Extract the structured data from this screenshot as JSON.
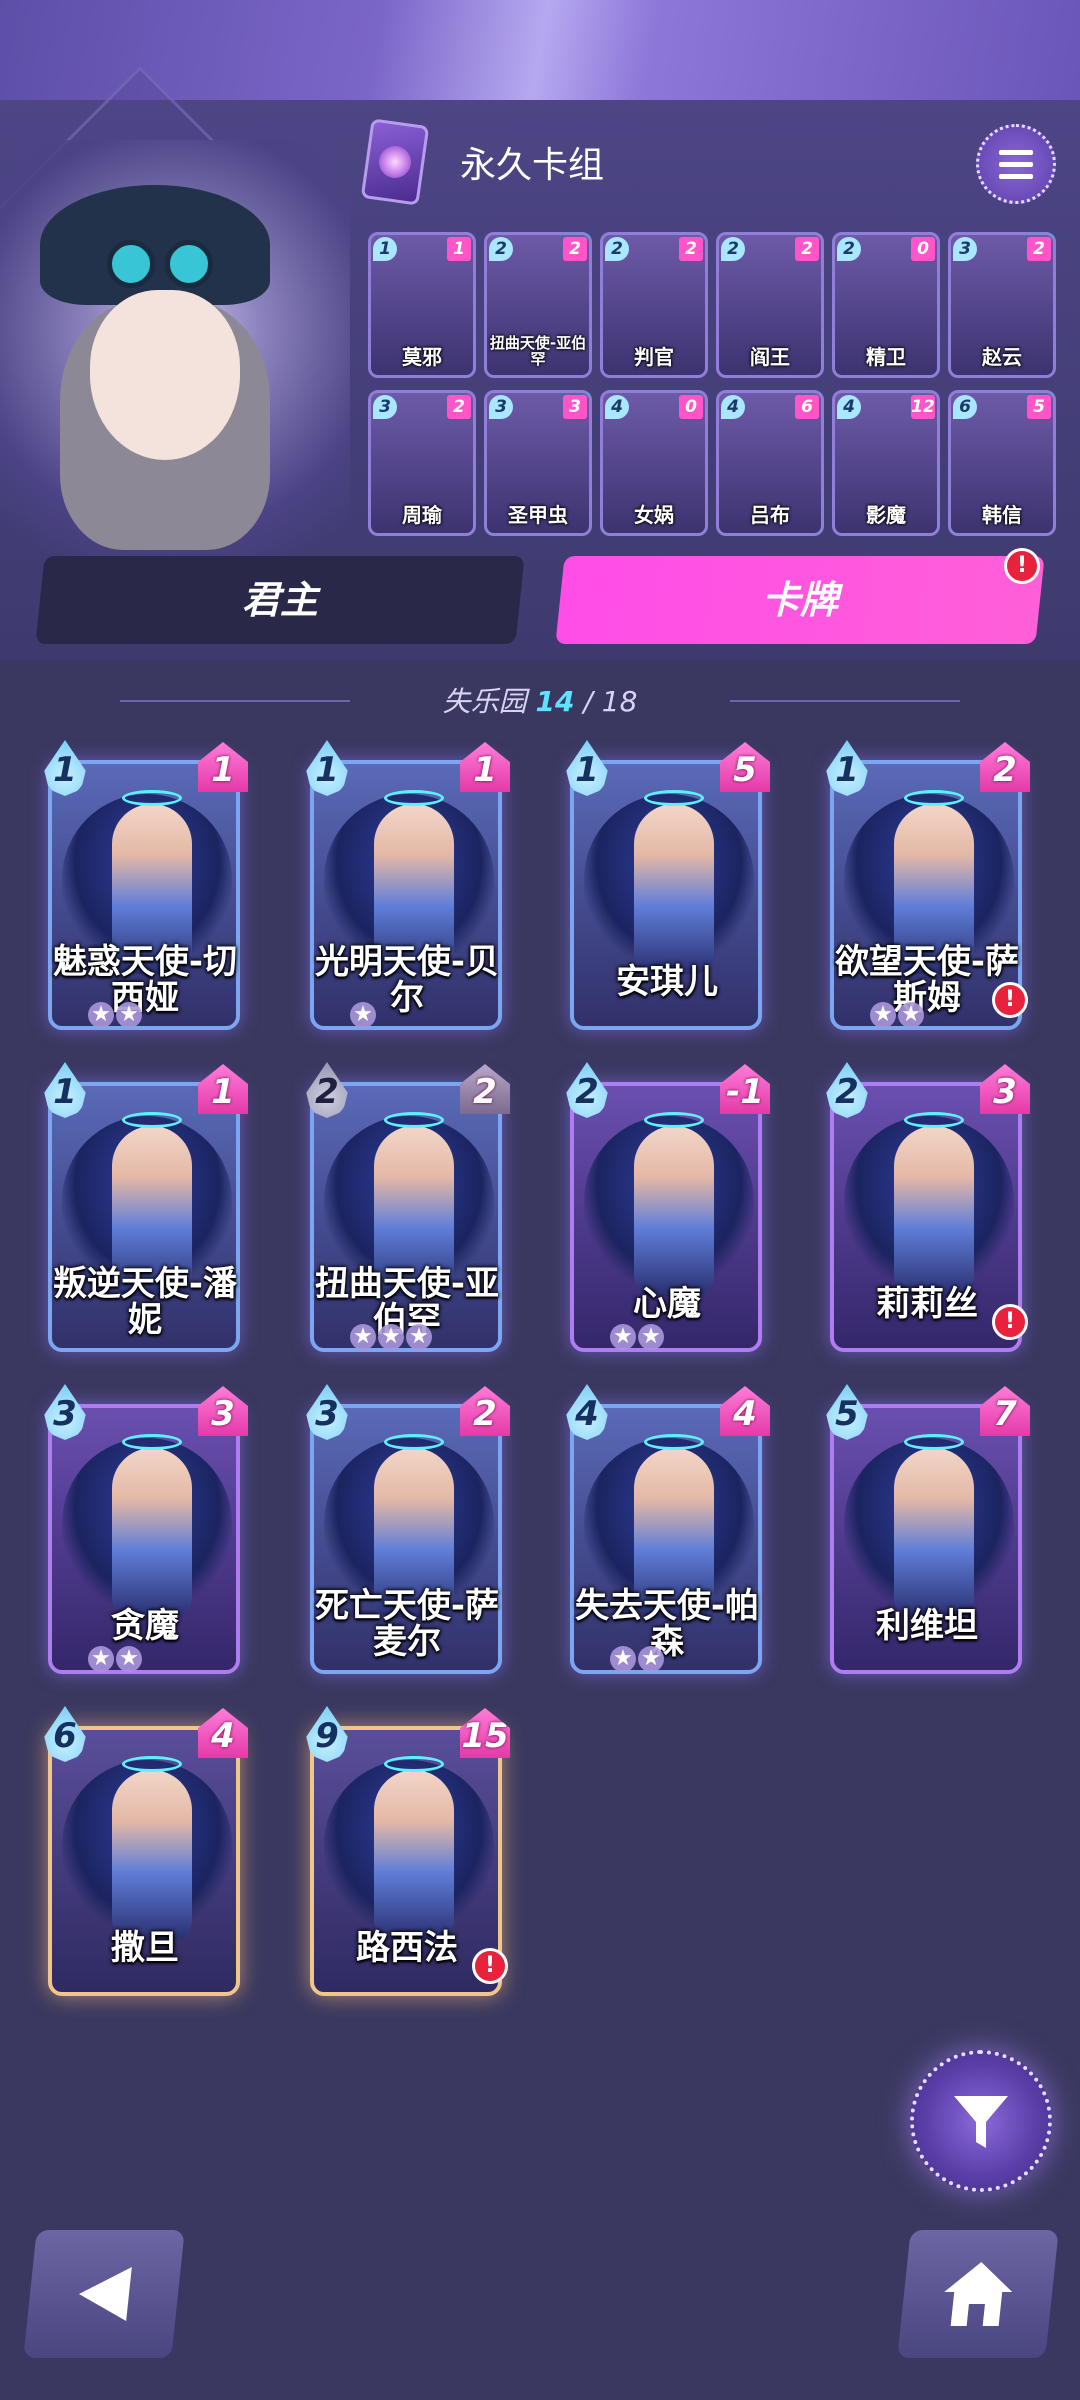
{
  "header": {
    "deck_title": "永久卡组"
  },
  "tabs": [
    {
      "label": "君主"
    },
    {
      "label": "卡牌"
    }
  ],
  "alert_mark": "!",
  "deck_cards": [
    {
      "cost": "1",
      "power": "1",
      "name": "莫邪"
    },
    {
      "cost": "2",
      "power": "2",
      "name": "扭曲天使-亚伯罕"
    },
    {
      "cost": "2",
      "power": "2",
      "name": "判官"
    },
    {
      "cost": "2",
      "power": "2",
      "name": "阎王"
    },
    {
      "cost": "2",
      "power": "0",
      "name": "精卫"
    },
    {
      "cost": "3",
      "power": "2",
      "name": "赵云"
    },
    {
      "cost": "3",
      "power": "2",
      "name": "周瑜"
    },
    {
      "cost": "3",
      "power": "3",
      "name": "圣甲虫"
    },
    {
      "cost": "4",
      "power": "0",
      "name": "女娲"
    },
    {
      "cost": "4",
      "power": "6",
      "name": "吕布"
    },
    {
      "cost": "4",
      "power": "12",
      "name": "影魔"
    },
    {
      "cost": "6",
      "power": "5",
      "name": "韩信"
    }
  ],
  "collection": {
    "name": "失乐园",
    "owned": "14",
    "separator": "/",
    "total": "18"
  },
  "cards": [
    {
      "cost": "1",
      "power": "1",
      "name": "魅惑天使-切西娅",
      "stars": 2,
      "alert": false
    },
    {
      "cost": "1",
      "power": "1",
      "name": "光明天使-贝尔",
      "stars": 1,
      "alert": false
    },
    {
      "cost": "1",
      "power": "5",
      "name": "安琪儿",
      "stars": 0,
      "alert": false
    },
    {
      "cost": "1",
      "power": "2",
      "name": "欲望天使-萨斯姆",
      "stars": 2,
      "alert": true
    },
    {
      "cost": "1",
      "power": "1",
      "name": "叛逆天使-潘妮",
      "stars": 0,
      "alert": false
    },
    {
      "cost": "2",
      "power": "2",
      "name": "扭曲天使-亚伯罕",
      "stars": 3,
      "alert": false
    },
    {
      "cost": "2",
      "power": "-1",
      "name": "心魔",
      "stars": 2,
      "alert": false
    },
    {
      "cost": "2",
      "power": "3",
      "name": "莉莉丝",
      "stars": 0,
      "alert": true
    },
    {
      "cost": "3",
      "power": "3",
      "name": "贪魔",
      "stars": 2,
      "alert": false
    },
    {
      "cost": "3",
      "power": "2",
      "name": "死亡天使-萨麦尔",
      "stars": 0,
      "alert": false
    },
    {
      "cost": "4",
      "power": "4",
      "name": "失去天使-帕森",
      "stars": 2,
      "alert": false
    },
    {
      "cost": "5",
      "power": "7",
      "name": "利维坦",
      "stars": 0,
      "alert": false
    },
    {
      "cost": "6",
      "power": "4",
      "name": "撒旦",
      "stars": 0,
      "alert": false
    },
    {
      "cost": "9",
      "power": "15",
      "name": "路西法",
      "stars": 0,
      "alert": true
    }
  ],
  "icons": {
    "menu": "hamburger-menu-icon",
    "filter": "filter-funnel-icon",
    "back": "back-arrow-icon",
    "home": "home-icon",
    "deck": "deck-emblem-icon"
  },
  "colors": {
    "accent_pink": "#ff4de8",
    "count_highlight": "#5ee2ff",
    "alert_red": "#e8213d"
  }
}
